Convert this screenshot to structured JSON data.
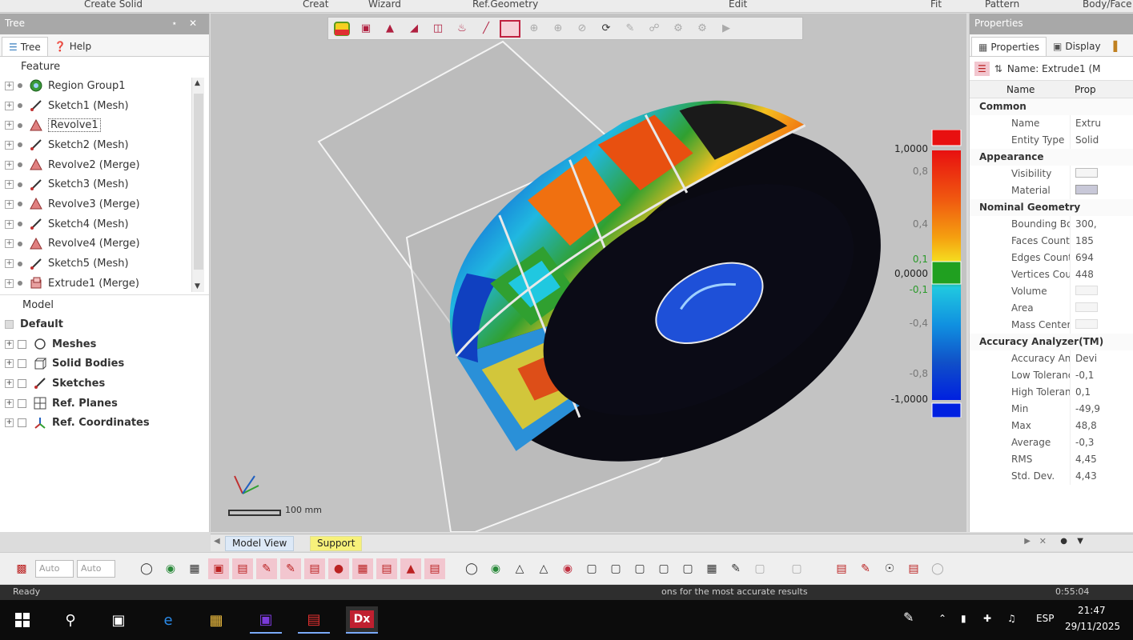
{
  "ribbon": {
    "groups": [
      "Create Solid",
      "Creat",
      "Wizard",
      "Ref.Geometry",
      "Edit",
      "Fit",
      "Pattern",
      "Body/Face"
    ]
  },
  "tree_panel": {
    "title": "Tree",
    "pin_icon": "pin-icon",
    "close_icon": "close-icon",
    "tabs": [
      {
        "label": "Tree",
        "icon": "tree-icon"
      },
      {
        "label": "Help",
        "icon": "help-icon"
      }
    ],
    "feature_label": "Feature",
    "features": [
      {
        "label": "Region Group1",
        "icon": "region-group-icon"
      },
      {
        "label": "Sketch1 (Mesh)",
        "icon": "sketch-icon"
      },
      {
        "label": "Revolve1",
        "icon": "revolve-icon",
        "selected": true
      },
      {
        "label": "Sketch2 (Mesh)",
        "icon": "sketch-icon"
      },
      {
        "label": "Revolve2 (Merge)",
        "icon": "revolve-icon"
      },
      {
        "label": "Sketch3 (Mesh)",
        "icon": "sketch-icon"
      },
      {
        "label": "Revolve3 (Merge)",
        "icon": "revolve-icon"
      },
      {
        "label": "Sketch4 (Mesh)",
        "icon": "sketch-icon"
      },
      {
        "label": "Revolve4 (Merge)",
        "icon": "revolve-icon"
      },
      {
        "label": "Sketch5 (Mesh)",
        "icon": "sketch-icon"
      },
      {
        "label": "Extrude1 (Merge)",
        "icon": "extrude-icon"
      }
    ],
    "model_label": "Model",
    "model_root": "Default",
    "model_items": [
      {
        "label": "Meshes",
        "icon": "mesh-icon"
      },
      {
        "label": "Solid Bodies",
        "icon": "solid-body-icon"
      },
      {
        "label": "Sketches",
        "icon": "sketch-icon"
      },
      {
        "label": "Ref. Planes",
        "icon": "ref-plane-icon"
      },
      {
        "label": "Ref. Coordinates",
        "icon": "ref-coordinates-icon"
      }
    ]
  },
  "viewport": {
    "toolbar_icons": [
      "color-map-icon",
      "view-cube-icon",
      "section-icon",
      "section-2-icon",
      "split-view-icon",
      "material-icon",
      "line-icon",
      "selection-box-icon",
      "dim-1-icon",
      "dim-2-icon",
      "dim-3-icon",
      "rotate-icon",
      "dim-4-icon",
      "dim-5-icon",
      "dim-6-icon",
      "dim-7-icon",
      "dim-8-icon"
    ],
    "color_bar": {
      "labels": [
        "1,0000",
        "0,8",
        "0,4",
        "0,1",
        "0,0000",
        "-0,1",
        "-0,4",
        "-0,8",
        "-1,0000"
      ],
      "max": 1.0,
      "min": -1.0,
      "colors": [
        "#e81010",
        "#f05010",
        "#f5a010",
        "#f5e020",
        "#20a020",
        "#20c8e0",
        "#1090e0",
        "#1050c8",
        "#0020e0"
      ]
    },
    "scale_label": "100 mm",
    "axis_icon": "xyz-axis-icon"
  },
  "view_tabs": [
    {
      "label": "Model View",
      "active": true
    },
    {
      "label": "Support",
      "active": false
    }
  ],
  "props_panel": {
    "title": "Properties",
    "tabs": [
      {
        "label": "Properties",
        "icon": "properties-icon"
      },
      {
        "label": "Display",
        "icon": "display-icon"
      }
    ],
    "name_field": "Name: Extrude1 (M",
    "col_name": "Name",
    "col_prop": "Prop",
    "categories": [
      {
        "label": "Common",
        "rows": [
          {
            "k": "Name",
            "v": "Extru"
          },
          {
            "k": "Entity Type",
            "v": "Solid"
          }
        ]
      },
      {
        "label": "Appearance",
        "rows": [
          {
            "k": "Visibility",
            "v": ""
          },
          {
            "k": "Material",
            "v": ""
          }
        ]
      },
      {
        "label": "Nominal Geometry",
        "rows": [
          {
            "k": "Bounding Box",
            "v": "300,"
          },
          {
            "k": "Faces Count",
            "v": "185"
          },
          {
            "k": "Edges Count",
            "v": "694"
          },
          {
            "k": "Vertices Count",
            "v": "448"
          },
          {
            "k": "Volume",
            "v": ""
          },
          {
            "k": "Area",
            "v": ""
          },
          {
            "k": "Mass Center",
            "v": ""
          }
        ]
      },
      {
        "label": "Accuracy Analyzer(TM)",
        "rows": [
          {
            "k": "Accuracy Analyz...",
            "v": "Devi"
          },
          {
            "k": "Low Tolerance",
            "v": "-0,1"
          },
          {
            "k": "High Tolerance",
            "v": "0,1"
          },
          {
            "k": "Min",
            "v": "-49,9"
          },
          {
            "k": "Max",
            "v": "48,8"
          },
          {
            "k": "Average",
            "v": "-0,3"
          },
          {
            "k": "RMS",
            "v": "4,45"
          },
          {
            "k": "Std. Dev.",
            "v": "4,43"
          }
        ]
      }
    ]
  },
  "bottom_toolbar": {
    "combo1": "Auto",
    "combo2": "Auto"
  },
  "status": {
    "left": "Ready",
    "center": "ons for the most accurate results",
    "right": "0:55:04"
  },
  "taskbar": {
    "apps": [
      "windows-start-icon",
      "search-icon",
      "task-view-icon",
      "edge-icon",
      "file-explorer-icon",
      "save-app-icon",
      "app-red-icon",
      "dx-app-icon"
    ],
    "dx_label": "Dx",
    "lang": "ESP",
    "time": "21:47",
    "date": "29/11/2025"
  }
}
